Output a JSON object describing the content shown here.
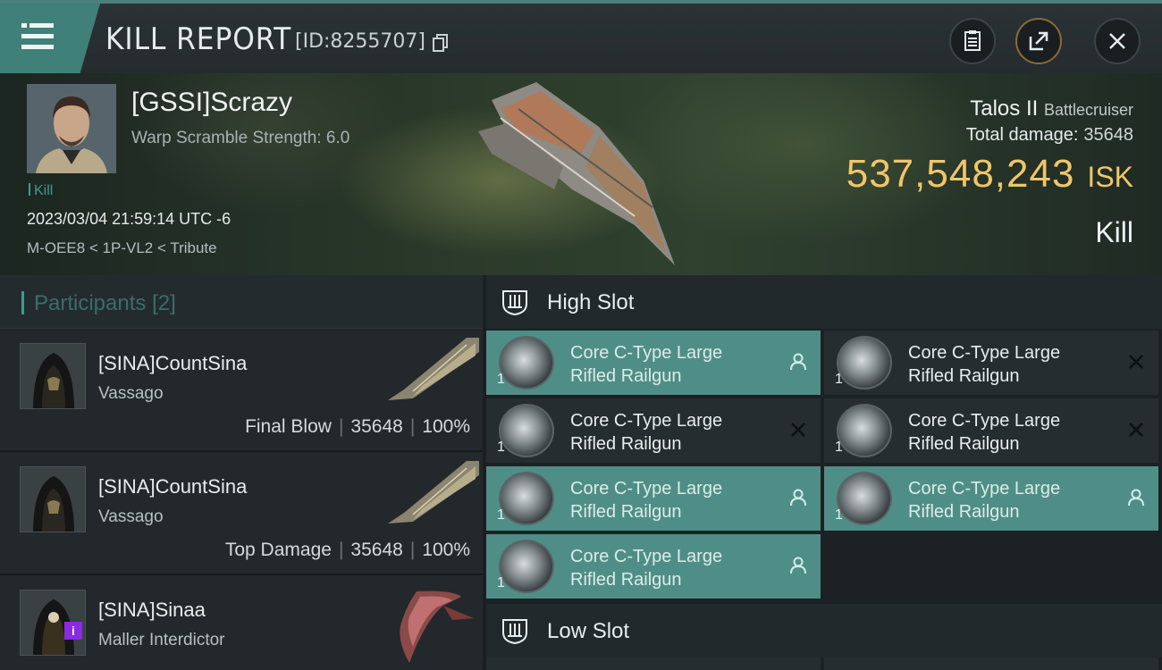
{
  "header": {
    "title": "KILL REPORT",
    "id_text": "[ID:8255707]"
  },
  "victim": {
    "name": "[GSSI]Scrazy",
    "warp_scramble": "Warp Scramble Strength: 6.0",
    "kill_tag": "Kill",
    "datetime": "2023/03/04 21:59:14 UTC -6",
    "location": "M-OEE8 < 1P-VL2 < Tribute",
    "ship_name": "Talos II",
    "ship_class": "Battlecruiser",
    "total_damage_label": "Total damage:",
    "total_damage": "35648",
    "isk_value": "537,548,243",
    "isk_unit": "ISK",
    "result": "Kill"
  },
  "participants": {
    "title": "Participants",
    "count": "[2]",
    "items": [
      {
        "name": "[SINA]CountSina",
        "ship": "Vassago",
        "role": "Final Blow",
        "damage": "35648",
        "percent": "100%"
      },
      {
        "name": "[SINA]CountSina",
        "ship": "Vassago",
        "role": "Top Damage",
        "damage": "35648",
        "percent": "100%"
      },
      {
        "name": "[SINA]Sinaa",
        "ship": "Maller Interdictor",
        "badge": "i"
      }
    ]
  },
  "fitting": {
    "high_slot_label": "High Slot",
    "low_slot_label": "Low Slot",
    "modules": [
      {
        "line1": "Core C-Type Large",
        "line2": "Rifled Railgun",
        "qty": "1",
        "state": "fitted"
      },
      {
        "line1": "Core C-Type Large",
        "line2": "Rifled Railgun",
        "qty": "1",
        "state": "destroyed"
      },
      {
        "line1": "Core C-Type Large",
        "line2": "Rifled Railgun",
        "qty": "1",
        "state": "destroyed"
      },
      {
        "line1": "Core C-Type Large",
        "line2": "Rifled Railgun",
        "qty": "1",
        "state": "destroyed"
      },
      {
        "line1": "Core C-Type Large",
        "line2": "Rifled Railgun",
        "qty": "1",
        "state": "fitted"
      },
      {
        "line1": "Core C-Type Large",
        "line2": "Rifled Railgun",
        "qty": "1",
        "state": "fitted"
      },
      {
        "line1": "Core C-Type Large",
        "line2": "Rifled Railgun",
        "qty": "1",
        "state": "fitted"
      }
    ]
  },
  "colors": {
    "accent": "#3f8078",
    "fitted_bg": "#4f8e86",
    "isk_gold": "#f0c66a"
  },
  "icons": {
    "menu": "menu-icon",
    "copy": "copy-icon",
    "clipboard": "clipboard-icon",
    "share": "share-icon",
    "close": "close-icon",
    "slot": "slot-icon",
    "pilot": "pilot-icon",
    "destroyed": "x-icon"
  }
}
